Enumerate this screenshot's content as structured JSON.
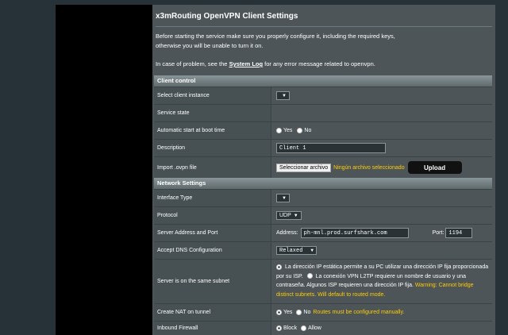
{
  "page": {
    "title": "x3mRouting OpenVPN Client Settings",
    "intro_line1": "Before starting the service make sure you properly configure it, including the required keys,",
    "intro_line2": "otherwise you will be unable to turn it on.",
    "problem_prefix": "In case of problem, see the ",
    "problem_link": "System Log",
    "problem_suffix": " for any error message related to openvpn."
  },
  "client_control": {
    "header": "Client control",
    "select_instance_label": "Select client instance",
    "service_state_label": "Service state",
    "auto_start_label": "Automatic start at boot time",
    "auto_start_yes": "Yes",
    "auto_start_no": "No",
    "description_label": "Description",
    "description_value": "Client 1",
    "import_label": "Import .ovpn file",
    "file_button": "Seleccionar archivo",
    "file_status": "Ningún archivo seleccionado",
    "upload_button": "Upload"
  },
  "network_settings": {
    "header": "Network Settings",
    "interface_type_label": "Interface Type",
    "protocol_label": "Protocol",
    "protocol_value": "UDP",
    "server_label": "Server Address and Port",
    "address_label": "Address:",
    "address_value": "ph-mnl.prod.surfshark.com",
    "port_label": "Port:",
    "port_value": "1194",
    "dns_label": "Accept DNS Configuration",
    "dns_value": "Relaxed",
    "same_subnet_label": "Server is on the same subnet",
    "same_subnet_opt1": "La dirección IP estática permite a su PC utilizar una dirección IP fija proporcionada por su ISP.",
    "same_subnet_opt2": "La conexión VPN L2TP requiere un nombre de usuario y una contraseña. Algunos ISP requieren una dirección IP fija.",
    "same_subnet_warn": "Warning: Cannot bridge distinct subnets. Will default to routed mode.",
    "nat_label": "Create NAT on tunnel",
    "nat_yes": "Yes",
    "nat_no": "No",
    "nat_note": "Routes must be configured manually.",
    "firewall_label": "Inbound Firewall",
    "firewall_block": "Block",
    "firewall_allow": "Allow"
  }
}
